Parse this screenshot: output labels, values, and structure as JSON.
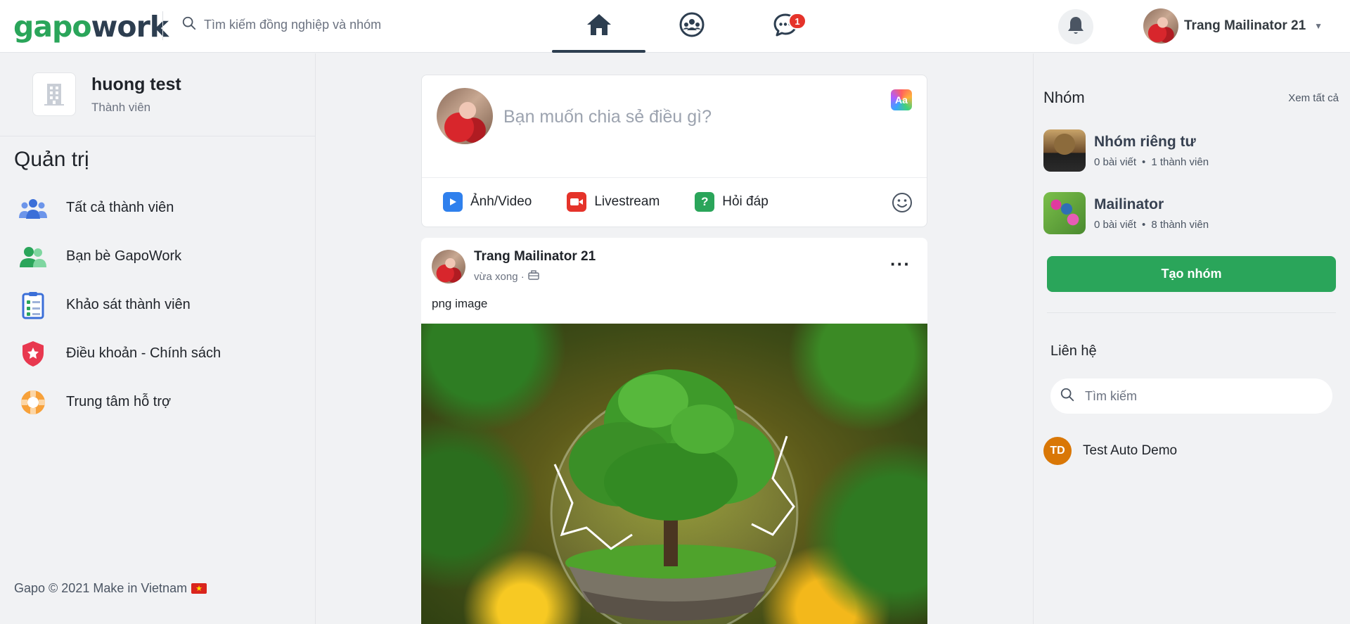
{
  "header": {
    "logo_part1": "gapo",
    "logo_part2": "work",
    "search_placeholder": "Tìm kiếm đồng nghiệp và nhóm",
    "chat_badge": "1",
    "user_name": "Trang Mailinator 21"
  },
  "left": {
    "org_name": "huong test",
    "org_role": "Thành viên",
    "admin_title": "Quản trị",
    "menu": [
      {
        "label": "Tất cả thành viên",
        "icon": "people-group-icon"
      },
      {
        "label": "Bạn bè GapoWork",
        "icon": "friends-icon"
      },
      {
        "label": "Khảo sát thành viên",
        "icon": "survey-clipboard-icon"
      },
      {
        "label": "Điều khoản - Chính sách",
        "icon": "shield-star-icon"
      },
      {
        "label": "Trung tâm hỗ trợ",
        "icon": "lifebuoy-icon"
      }
    ],
    "footer": "Gapo © 2021 Make in Vietnam"
  },
  "composer": {
    "placeholder": "Bạn muốn chia sẻ điều gì?",
    "aa_label": "Aa",
    "actions": [
      {
        "label": "Ảnh/Video",
        "color": "#2f80ed"
      },
      {
        "label": "Livestream",
        "color": "#e5332a"
      },
      {
        "label": "Hỏi đáp",
        "color": "#2aa55a"
      }
    ]
  },
  "post": {
    "author": "Trang Mailinator 21",
    "time": "vừa xong ·",
    "text": "png image",
    "more": "···"
  },
  "right": {
    "groups_title": "Nhóm",
    "see_all": "Xem tất cả",
    "groups": [
      {
        "name": "Nhóm riêng tư",
        "posts": "0 bài viết",
        "members": "1 thành viên"
      },
      {
        "name": "Mailinator",
        "posts": "0 bài viết",
        "members": "8 thành viên"
      }
    ],
    "create_group": "Tạo nhóm",
    "contacts_title": "Liên hệ",
    "contacts_search_placeholder": "Tìm kiếm",
    "contacts": [
      {
        "initials": "TD",
        "name": "Test Auto Demo"
      }
    ]
  },
  "colors": {
    "brand_green": "#2aa55a",
    "brand_dark": "#2d3e50",
    "badge_red": "#e5332a"
  }
}
